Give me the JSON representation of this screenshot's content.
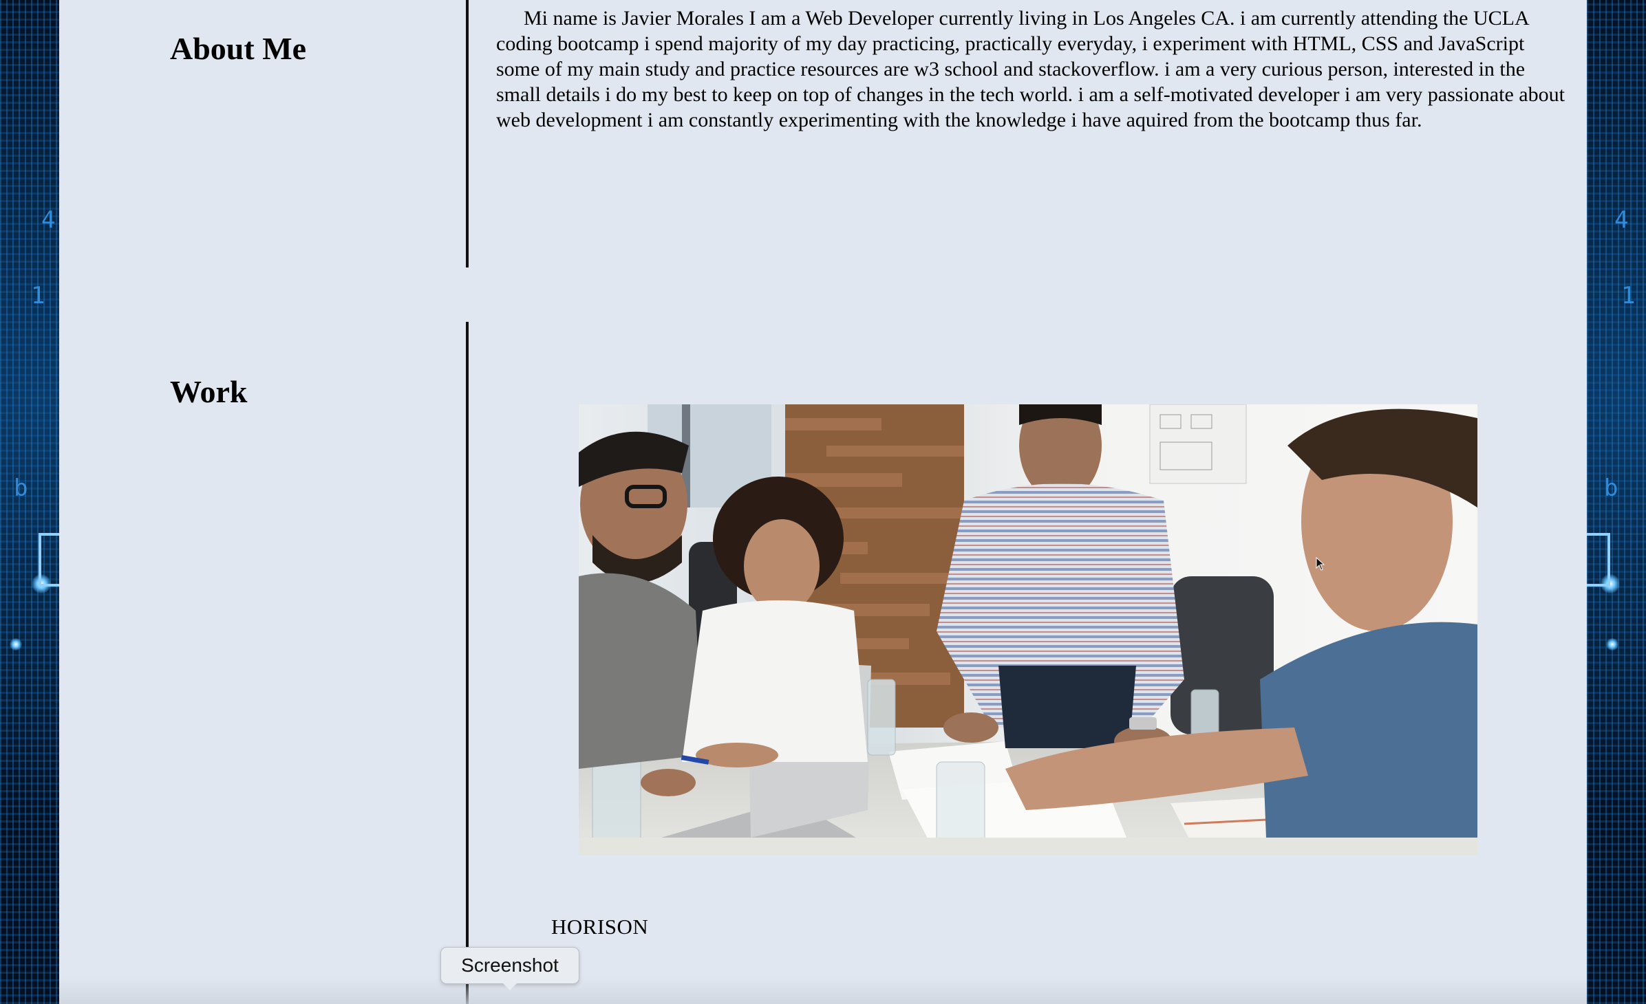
{
  "about": {
    "heading": "About Me",
    "text": "Mi name is Javier Morales I am a Web Developer currently living in Los Angeles CA. i am currently attending the UCLA coding bootcamp i spend majority of my day practicing, practically everyday, i experiment with HTML, CSS and JavaScript some of my main study and practice resources are w3 school and stackoverflow. i am a very curious person, interested in the small details i do my best to keep on top of changes in the tech world. i am a self-motivated developer i am very passionate about web development i am constantly experimenting with the knowledge i have aquired from the bootcamp thus far."
  },
  "work": {
    "heading": "Work",
    "project_title": "HORISON"
  },
  "tooltip": {
    "label": "Screenshot"
  },
  "colors": {
    "page_background": "#e1e7f0",
    "side_background": "#031627",
    "divider": "#111111"
  }
}
